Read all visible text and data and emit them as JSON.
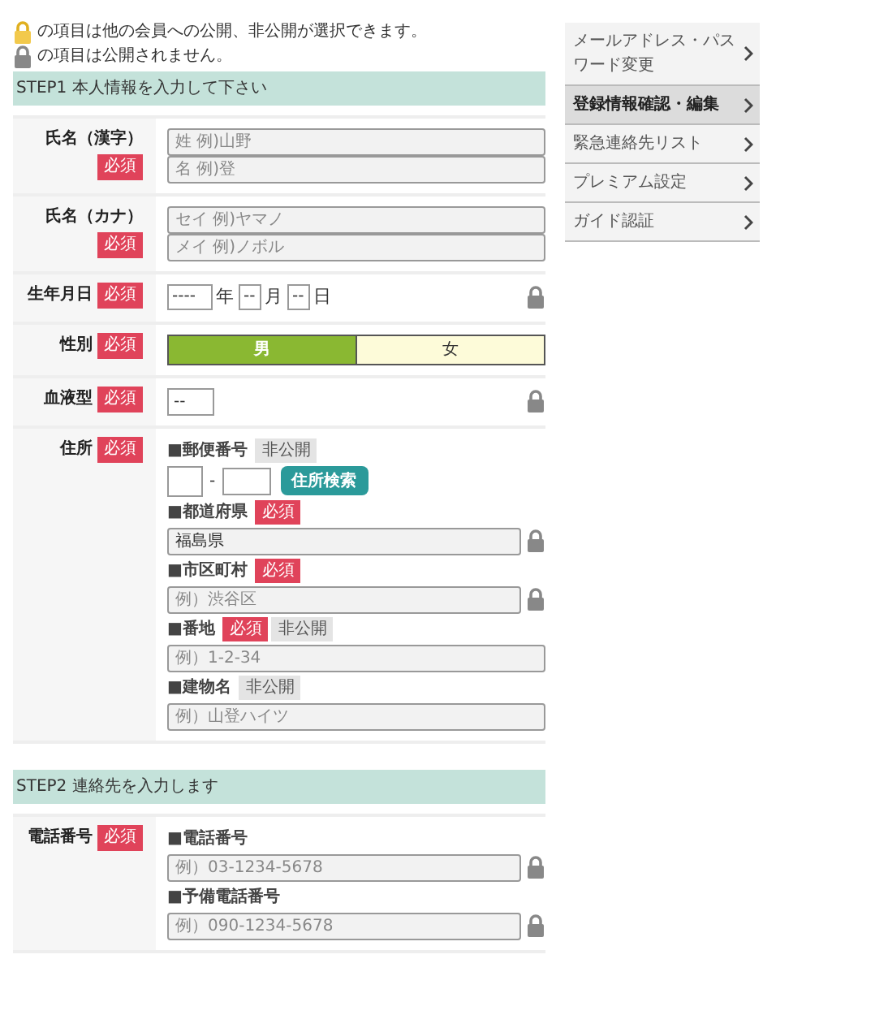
{
  "notes": [
    {
      "kind": "open",
      "text": "の項目は他の会員への公開、非公開が選択できます。"
    },
    {
      "kind": "closed",
      "text": "の項目は公開されません。"
    }
  ],
  "sections": [
    {
      "title": "STEP1 本人情報を入力して下さい",
      "rows": [
        {
          "label": "氏名（漢字）",
          "badge": "必須",
          "stacked": true,
          "kind": "inputs",
          "locked": false,
          "fields": [
            {
              "placeholder": "姓 例)山野"
            },
            {
              "placeholder": "名 例)登"
            }
          ]
        },
        {
          "label": "氏名（カナ）",
          "badge": "必須",
          "stacked": true,
          "kind": "inputs",
          "locked": false,
          "fields": [
            {
              "placeholder": "セイ 例)ヤマノ"
            },
            {
              "placeholder": "メイ 例)ノボル"
            }
          ]
        },
        {
          "label": "生年月日",
          "badge": "必須",
          "stacked": false,
          "kind": "date",
          "locked": true,
          "parts": [
            {
              "value": "----",
              "unit": "年"
            },
            {
              "value": "--",
              "unit": "月"
            },
            {
              "value": "--",
              "unit": "日"
            }
          ]
        },
        {
          "label": "性別",
          "badge": "必須",
          "stacked": false,
          "kind": "toggle",
          "locked": false,
          "options": [
            {
              "label": "男",
              "selected": true
            },
            {
              "label": "女",
              "selected": false
            }
          ]
        },
        {
          "label": "血液型",
          "badge": "必須",
          "stacked": false,
          "kind": "select",
          "locked": true,
          "value": "--"
        },
        {
          "label": "住所",
          "badge": "必須",
          "stacked": false,
          "kind": "group",
          "subfields": [
            {
              "label": "■郵便番号",
              "badges": [
                {
                  "kind": "private",
                  "text": "非公開"
                }
              ],
              "kind": "zip",
              "locked": false,
              "separator": "-",
              "button": "住所検索"
            },
            {
              "label": "■都道府県",
              "badges": [
                {
                  "kind": "required",
                  "text": "必須"
                }
              ],
              "kind": "text",
              "locked": true,
              "value": "福島県"
            },
            {
              "label": "■市区町村",
              "badges": [
                {
                  "kind": "required",
                  "text": "必須"
                }
              ],
              "kind": "text",
              "locked": true,
              "placeholder": "例）渋谷区"
            },
            {
              "label": "■番地",
              "badges": [
                {
                  "kind": "required",
                  "text": "必須"
                },
                {
                  "kind": "private",
                  "text": "非公開"
                }
              ],
              "kind": "text",
              "locked": false,
              "placeholder": "例）1-2-34"
            },
            {
              "label": "■建物名",
              "badges": [
                {
                  "kind": "private",
                  "text": "非公開"
                }
              ],
              "kind": "text",
              "locked": false,
              "placeholder": "例）山登ハイツ"
            }
          ]
        }
      ]
    },
    {
      "title": "STEP2 連絡先を入力します",
      "rows": [
        {
          "label": "電話番号",
          "badge": "必須",
          "stacked": false,
          "kind": "group",
          "subfields": [
            {
              "label": "■電話番号",
              "kind": "text",
              "locked": true,
              "placeholder": "例）03-1234-5678"
            },
            {
              "label": "■予備電話番号",
              "kind": "text",
              "locked": true,
              "placeholder": "例）090-1234-5678"
            }
          ]
        }
      ]
    }
  ],
  "sidebar": {
    "items": [
      {
        "label": "メールアドレス・パスワード変更",
        "selected": false
      },
      {
        "label": "登録情報確認・編集",
        "selected": true
      },
      {
        "label": "緊急連絡先リスト",
        "selected": false
      },
      {
        "label": "プレミアム設定",
        "selected": false
      },
      {
        "label": "ガイド認証",
        "selected": false
      }
    ]
  }
}
